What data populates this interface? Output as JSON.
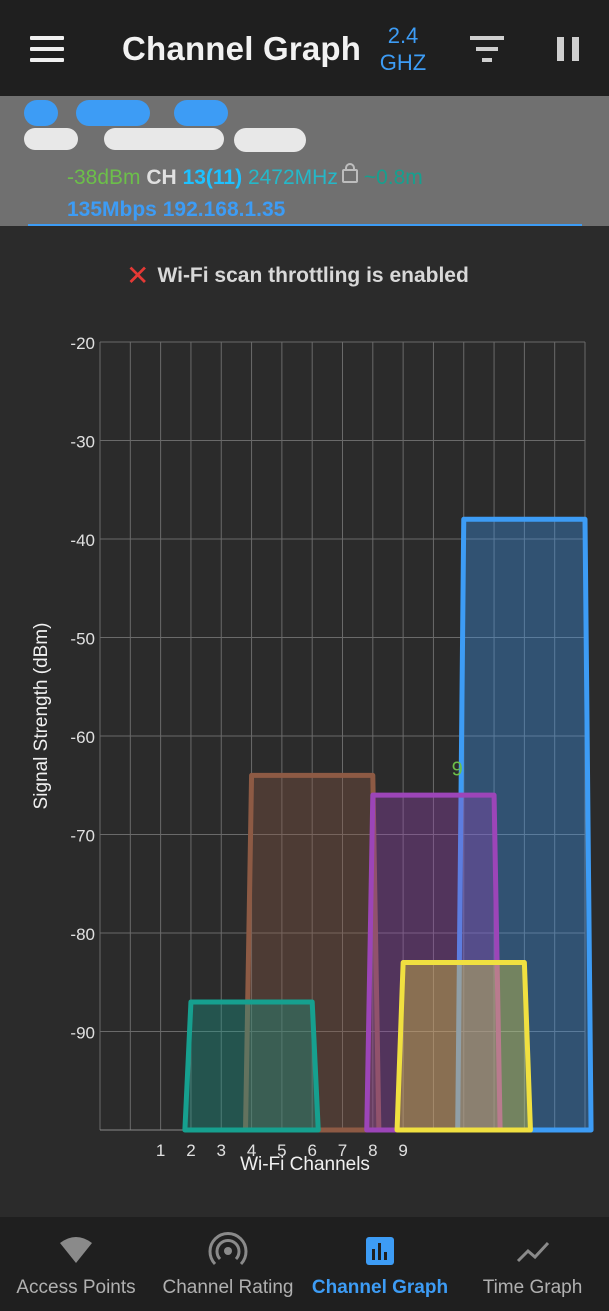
{
  "appbar": {
    "title": "Channel Graph",
    "band_line1": "2.4",
    "band_line2": "GHZ"
  },
  "connected_ap": {
    "signal": "-38dBm",
    "ch_label": "CH",
    "channel": "13(11)",
    "frequency": "2472MHz",
    "distance": "~0.8m",
    "link_speed": "135Mbps",
    "ip": "192.168.1.35"
  },
  "warning": {
    "text": "Wi-Fi scan throttling is enabled"
  },
  "chart_data": {
    "type": "area",
    "xlabel": "Wi-Fi Channels",
    "ylabel": "Signal Strength (dBm)",
    "ylim": [
      -100,
      -20
    ],
    "yticks": [
      -20,
      -30,
      -40,
      -50,
      -60,
      -70,
      -80,
      -90
    ],
    "xticks": [
      "1",
      "2",
      "3",
      "4",
      "5",
      "6",
      "7",
      "8",
      "9"
    ],
    "x_domain": [
      -1,
      15
    ],
    "grid": true,
    "series": [
      {
        "center": 13,
        "signal": -38,
        "color": "#3d9cf5"
      },
      {
        "center": 6,
        "signal": -64,
        "color": "#8d5a44"
      },
      {
        "center": 10,
        "signal": -66,
        "color": "#9c45b8"
      },
      {
        "center": 4,
        "signal": -87,
        "color": "#16a08f"
      },
      {
        "center": 11,
        "signal": -83,
        "color": "#f0e040"
      }
    ],
    "annotations": [
      "9"
    ]
  },
  "bottom_nav": {
    "items": [
      {
        "label": "Access Points",
        "icon": "wifi-icon"
      },
      {
        "label": "Channel Rating",
        "icon": "antenna-icon"
      },
      {
        "label": "Channel Graph",
        "icon": "bar-chart-icon",
        "active": true
      },
      {
        "label": "Time Graph",
        "icon": "line-chart-icon"
      }
    ]
  }
}
